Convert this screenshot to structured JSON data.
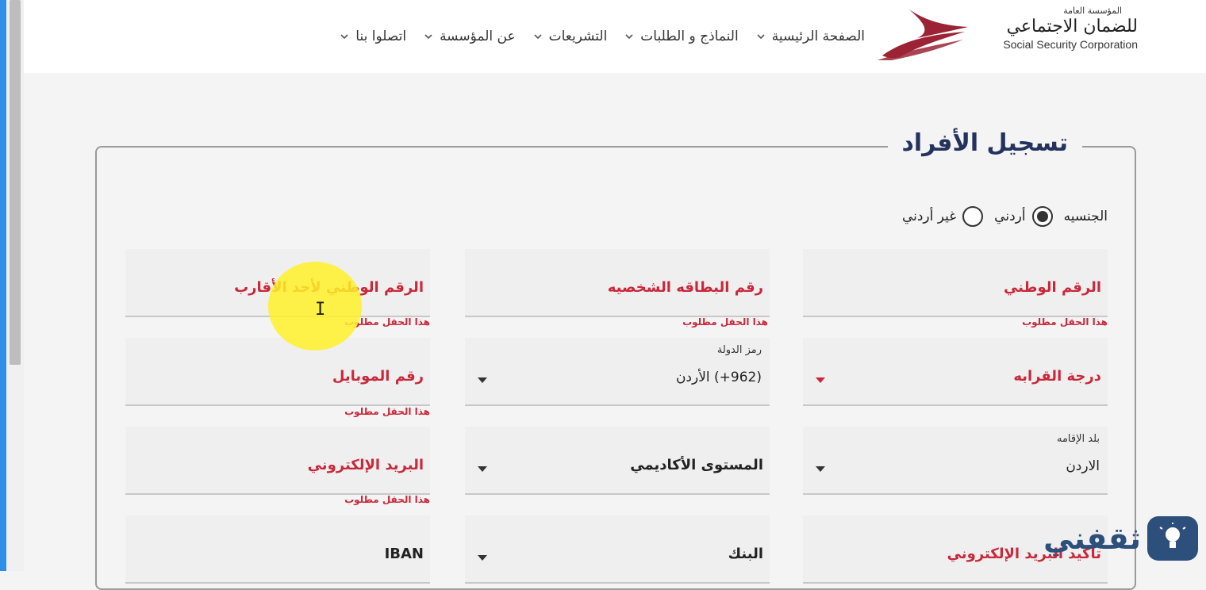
{
  "header": {
    "logo": {
      "ar_small": "المؤسسة العامة",
      "ar_main": "للضمان الاجتماعي",
      "en": "Social Security Corporation"
    },
    "nav": [
      {
        "label": "الصفحة الرئيسية"
      },
      {
        "label": "النماذج و الطلبات"
      },
      {
        "label": "التشريعات"
      },
      {
        "label": "عن المؤسسة"
      },
      {
        "label": "اتصلوا بنا"
      }
    ]
  },
  "form": {
    "title": "تسجيل الأفراد",
    "nationality": {
      "label": "الجنسيه",
      "options": [
        "أردني",
        "غير أردني"
      ],
      "selected": "أردني"
    },
    "fields": {
      "national_id": {
        "label": "الرقم الوطني",
        "error": "هذا الحقل مطلوب"
      },
      "id_card_number": {
        "label": "رقم البطاقه الشخصيه",
        "error": "هذا الحقل مطلوب"
      },
      "relative_national_id": {
        "label": "الرقم الوطني لأحد الأقارب",
        "error": "هذا الحقل مطلوب"
      },
      "relation_degree": {
        "label": "درجة القرابه"
      },
      "country_code": {
        "small_label": "رمز الدولة",
        "value": "(962+) الأردن"
      },
      "mobile": {
        "label": "رقم الموبايل",
        "error": "هذا الحقل مطلوب"
      },
      "residence_country": {
        "small_label": "بلد الإقامه",
        "value": "الاردن"
      },
      "academic_level": {
        "label": "المستوى الأكاديمي"
      },
      "email": {
        "label": "البريد الإلكتروني",
        "error": "هذا الحقل مطلوب"
      },
      "confirm_email": {
        "label": "تأكيد البريد الإلكتروني"
      },
      "bank": {
        "label": "البنك"
      },
      "iban": {
        "label": "IBAN"
      }
    }
  },
  "watermark": {
    "text": "ثقفني"
  },
  "colors": {
    "accent_red": "#c9283a",
    "title_navy": "#24325e",
    "logo_red": "#9b2335"
  }
}
